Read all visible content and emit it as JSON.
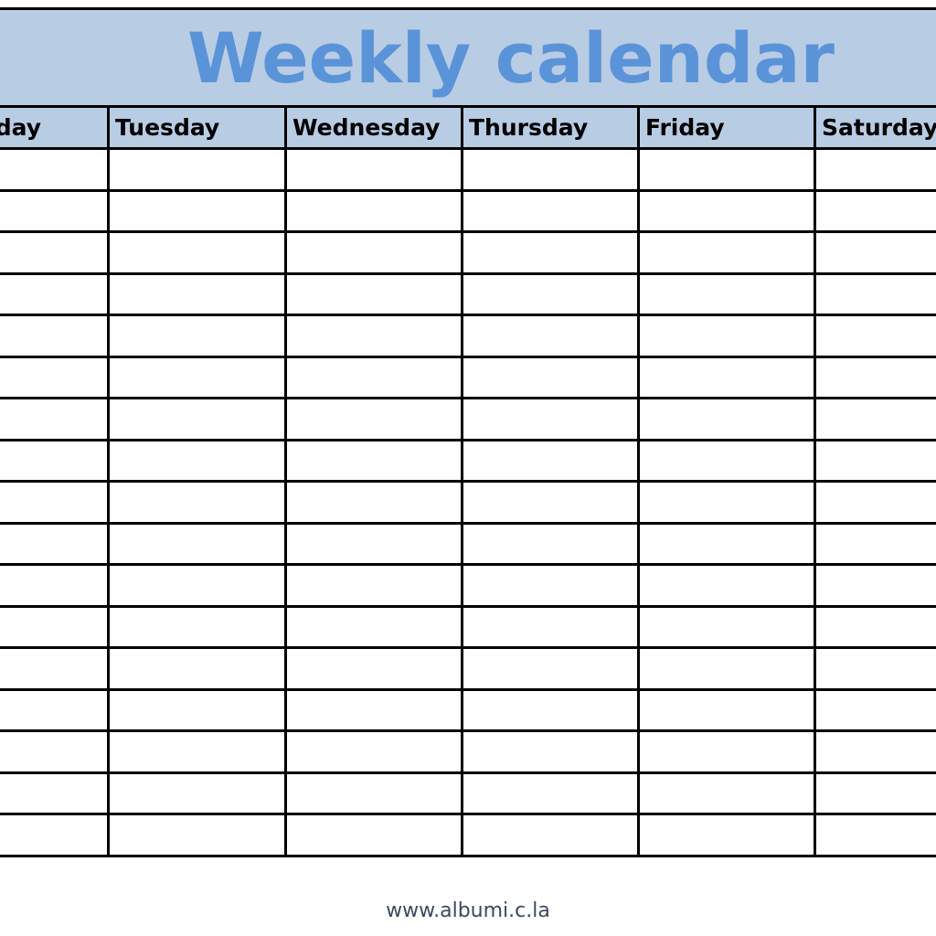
{
  "title": "Weekly calendar",
  "days": [
    {
      "label": "Monday"
    },
    {
      "label": "Tuesday"
    },
    {
      "label": "Wednesday"
    },
    {
      "label": "Thursday"
    },
    {
      "label": "Friday"
    },
    {
      "label": "Saturday"
    }
  ],
  "row_count": 17,
  "colors": {
    "header_bg": "#b8cce4",
    "title_text": "#5b93d8",
    "grid_line": "#000000"
  },
  "footer": {
    "url_text": "www.albumi.c.la"
  }
}
